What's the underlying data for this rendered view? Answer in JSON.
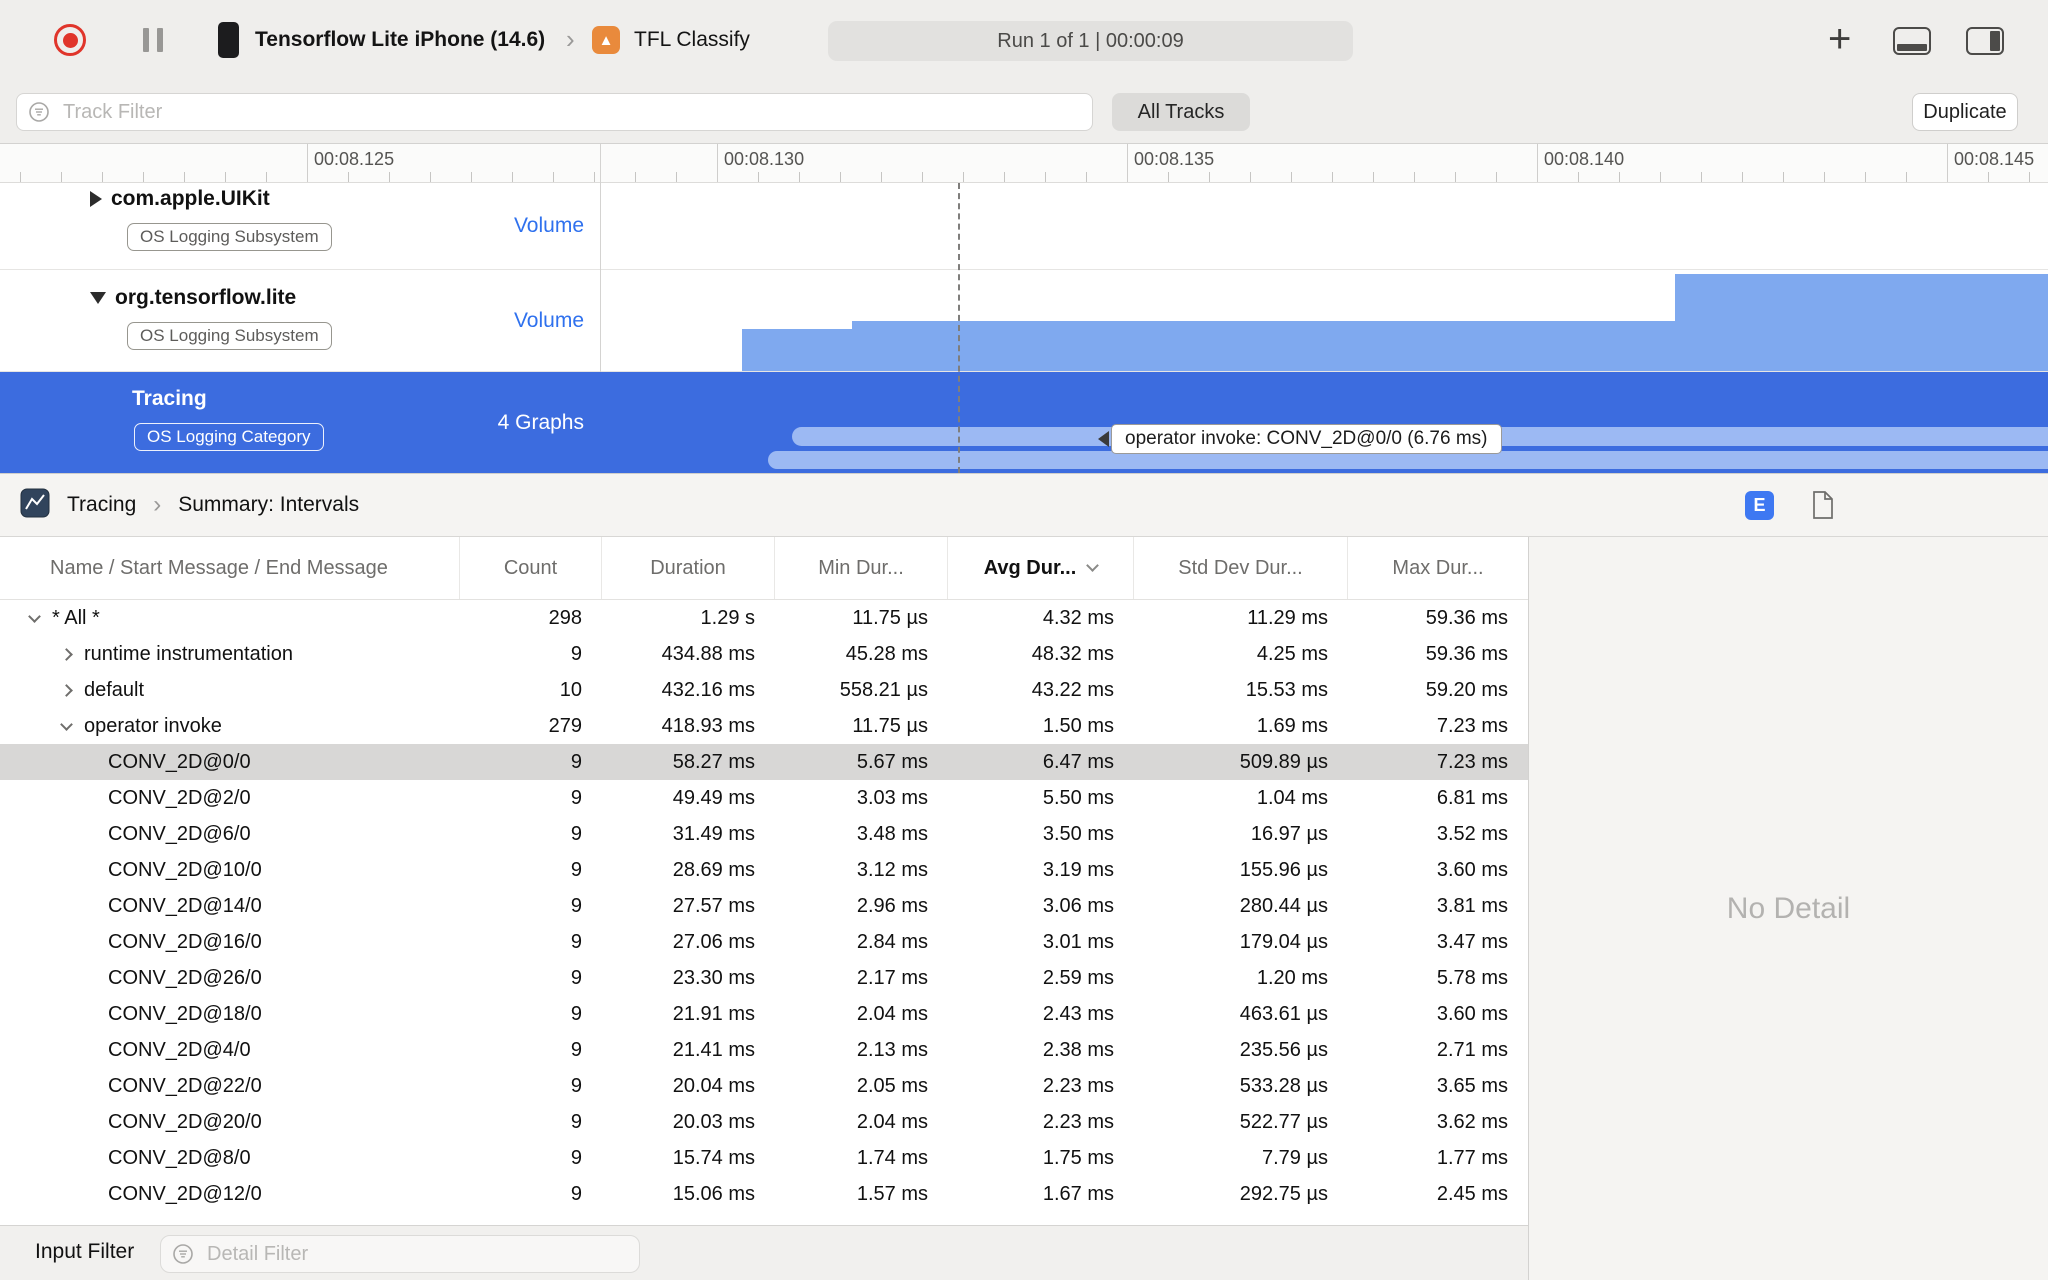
{
  "toolbar": {
    "device_name": "Tensorflow Lite iPhone (14.6)",
    "process_name": "TFL Classify",
    "run_status": "Run 1 of 1  |  00:00:09"
  },
  "filter_bar": {
    "track_filter_placeholder": "Track Filter",
    "all_tracks": "All Tracks",
    "duplicate": "Duplicate"
  },
  "ruler": {
    "labels": [
      "00:08.125",
      "00:08.130",
      "00:08.135",
      "00:08.140",
      "00:08.145"
    ]
  },
  "tracks": [
    {
      "name": "com.apple.UIKit",
      "badge": "OS Logging Subsystem",
      "meta": "Volume",
      "disclosure": "collapsed"
    },
    {
      "name": "org.tensorflow.lite",
      "badge": "OS Logging Subsystem",
      "meta": "Volume",
      "disclosure": "expanded"
    },
    {
      "name": "Tracing",
      "badge": "OS Logging Category",
      "meta": "4 Graphs",
      "selected": true
    }
  ],
  "track_tooltip": "operator invoke: CONV_2D@0/0 (6.76 ms)",
  "detail": {
    "breadcrumb_root": "Tracing",
    "breadcrumb_page": "Summary: Intervals",
    "detail_toggle": "E",
    "no_detail": "No Detail"
  },
  "table": {
    "columns": [
      "Name / Start Message / End Message",
      "Count",
      "Duration",
      "Min Dur...",
      "Avg Dur...",
      "Std Dev Dur...",
      "Max Dur..."
    ],
    "sort_column": "Avg Dur...",
    "rows": [
      {
        "name": "* All *",
        "indent": 0,
        "disclosure": "expanded",
        "count": "298",
        "duration": "1.29 s",
        "min": "11.75 µs",
        "avg": "4.32 ms",
        "std": "11.29 ms",
        "max": "59.36 ms"
      },
      {
        "name": "runtime instrumentation",
        "indent": 1,
        "disclosure": "collapsed",
        "count": "9",
        "duration": "434.88 ms",
        "min": "45.28 ms",
        "avg": "48.32 ms",
        "std": "4.25 ms",
        "max": "59.36 ms"
      },
      {
        "name": "default",
        "indent": 1,
        "disclosure": "collapsed",
        "count": "10",
        "duration": "432.16 ms",
        "min": "558.21 µs",
        "avg": "43.22 ms",
        "std": "15.53 ms",
        "max": "59.20 ms"
      },
      {
        "name": "operator invoke",
        "indent": 1,
        "disclosure": "expanded",
        "count": "279",
        "duration": "418.93 ms",
        "min": "11.75 µs",
        "avg": "1.50 ms",
        "std": "1.69 ms",
        "max": "7.23 ms"
      },
      {
        "name": "CONV_2D@0/0",
        "indent": 2,
        "selected": true,
        "count": "9",
        "duration": "58.27 ms",
        "min": "5.67 ms",
        "avg": "6.47 ms",
        "std": "509.89 µs",
        "max": "7.23 ms"
      },
      {
        "name": "CONV_2D@2/0",
        "indent": 2,
        "count": "9",
        "duration": "49.49 ms",
        "min": "3.03 ms",
        "avg": "5.50 ms",
        "std": "1.04 ms",
        "max": "6.81 ms"
      },
      {
        "name": "CONV_2D@6/0",
        "indent": 2,
        "count": "9",
        "duration": "31.49 ms",
        "min": "3.48 ms",
        "avg": "3.50 ms",
        "std": "16.97 µs",
        "max": "3.52 ms"
      },
      {
        "name": "CONV_2D@10/0",
        "indent": 2,
        "count": "9",
        "duration": "28.69 ms",
        "min": "3.12 ms",
        "avg": "3.19 ms",
        "std": "155.96 µs",
        "max": "3.60 ms"
      },
      {
        "name": "CONV_2D@14/0",
        "indent": 2,
        "count": "9",
        "duration": "27.57 ms",
        "min": "2.96 ms",
        "avg": "3.06 ms",
        "std": "280.44 µs",
        "max": "3.81 ms"
      },
      {
        "name": "CONV_2D@16/0",
        "indent": 2,
        "count": "9",
        "duration": "27.06 ms",
        "min": "2.84 ms",
        "avg": "3.01 ms",
        "std": "179.04 µs",
        "max": "3.47 ms"
      },
      {
        "name": "CONV_2D@26/0",
        "indent": 2,
        "count": "9",
        "duration": "23.30 ms",
        "min": "2.17 ms",
        "avg": "2.59 ms",
        "std": "1.20 ms",
        "max": "5.78 ms"
      },
      {
        "name": "CONV_2D@18/0",
        "indent": 2,
        "count": "9",
        "duration": "21.91 ms",
        "min": "2.04 ms",
        "avg": "2.43 ms",
        "std": "463.61 µs",
        "max": "3.60 ms"
      },
      {
        "name": "CONV_2D@4/0",
        "indent": 2,
        "count": "9",
        "duration": "21.41 ms",
        "min": "2.13 ms",
        "avg": "2.38 ms",
        "std": "235.56 µs",
        "max": "2.71 ms"
      },
      {
        "name": "CONV_2D@22/0",
        "indent": 2,
        "count": "9",
        "duration": "20.04 ms",
        "min": "2.05 ms",
        "avg": "2.23 ms",
        "std": "533.28 µs",
        "max": "3.65 ms"
      },
      {
        "name": "CONV_2D@20/0",
        "indent": 2,
        "count": "9",
        "duration": "20.03 ms",
        "min": "2.04 ms",
        "avg": "2.23 ms",
        "std": "522.77 µs",
        "max": "3.62 ms"
      },
      {
        "name": "CONV_2D@8/0",
        "indent": 2,
        "count": "9",
        "duration": "15.74 ms",
        "min": "1.74 ms",
        "avg": "1.75 ms",
        "std": "7.79 µs",
        "max": "1.77 ms"
      },
      {
        "name": "CONV_2D@12/0",
        "indent": 2,
        "count": "9",
        "duration": "15.06 ms",
        "min": "1.57 ms",
        "avg": "1.67 ms",
        "std": "292.75 µs",
        "max": "2.45 ms"
      }
    ]
  },
  "bottom_bar": {
    "input_filter": "Input Filter",
    "detail_filter_placeholder": "Detail Filter"
  },
  "colors": {
    "selection_blue": "#3c6cdf",
    "volume_chart_blue": "#7fa9ef",
    "interval_bar_blue": "#9cb9f3",
    "record_red": "#e0352b",
    "meta_label_blue": "#2f71ee"
  }
}
